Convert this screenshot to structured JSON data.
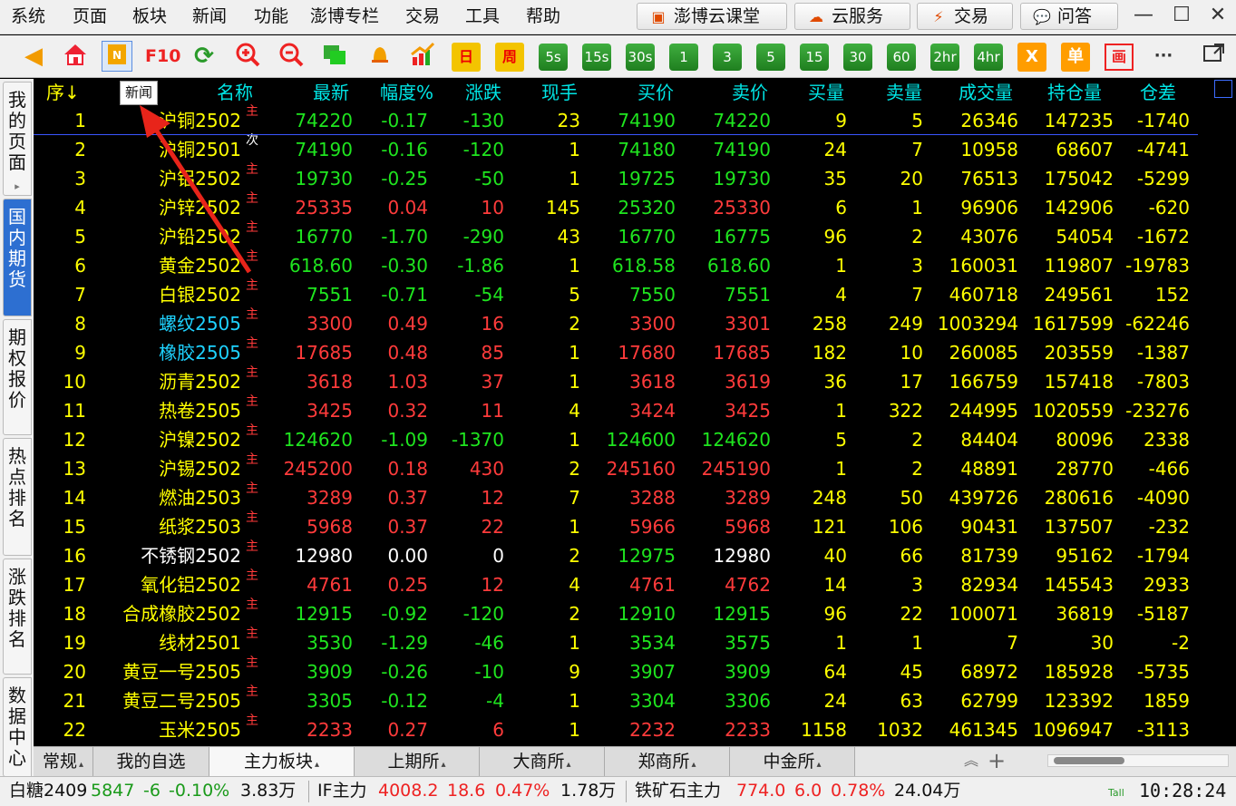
{
  "menu": [
    "系统",
    "页面",
    "板块",
    "新闻",
    "功能",
    "澎博专栏",
    "交易",
    "工具",
    "帮助"
  ],
  "top_buttons": [
    {
      "icon": "graduation-icon",
      "label": "澎博云课堂",
      "color": "#e04a00"
    },
    {
      "icon": "cloud-icon",
      "label": "云服务",
      "color": "#e04a00"
    },
    {
      "icon": "lightning-icon",
      "label": "交易",
      "color": "#e04a00"
    },
    {
      "icon": "chat-icon",
      "label": "问答",
      "color": "#666666"
    }
  ],
  "toolbar": {
    "f10_label": "F10",
    "day_label": "日",
    "week_label": "周",
    "periods": [
      "5s",
      "15s",
      "30s",
      "1",
      "3",
      "5",
      "15",
      "30",
      "60",
      "2hr",
      "4hr"
    ],
    "x_label": "X",
    "single_label": "单",
    "draw_label": "画",
    "more_label": "···"
  },
  "sidebar_tabs": [
    {
      "label": "我的页面",
      "arrow": "▸",
      "active": false
    },
    {
      "label": "国内期货",
      "active": true
    },
    {
      "label": "期权报价",
      "active": false
    },
    {
      "label": "热点排名",
      "active": false
    },
    {
      "label": "涨跌排名",
      "active": false
    },
    {
      "label": "数据中心",
      "active": false
    }
  ],
  "tooltip": "新闻",
  "columns": [
    "序↓",
    "名称",
    "最新",
    "幅度%",
    "涨跌",
    "现手",
    "买价",
    "卖价",
    "买量",
    "卖量",
    "成交量",
    "持仓量",
    "仓差"
  ],
  "rows": [
    {
      "i": "1",
      "n": "沪铜2502",
      "t": "主",
      "nc": "yellow",
      "p": "74220",
      "pct": "-0.17",
      "chg": "-130",
      "hand": "23",
      "bid": "74190",
      "ask": "74220",
      "bv": "9",
      "av": "5",
      "vol": "26346",
      "oi": "147235",
      "doi": "-1740",
      "c": "green"
    },
    {
      "i": "2",
      "n": "沪铜2501",
      "t": "次",
      "nc": "yellow",
      "p": "74190",
      "pct": "-0.16",
      "chg": "-120",
      "hand": "1",
      "bid": "74180",
      "ask": "74190",
      "bv": "24",
      "av": "7",
      "vol": "10958",
      "oi": "68607",
      "doi": "-4741",
      "c": "green"
    },
    {
      "i": "3",
      "n": "沪铝2502",
      "t": "主",
      "nc": "yellow",
      "p": "19730",
      "pct": "-0.25",
      "chg": "-50",
      "hand": "1",
      "bid": "19725",
      "ask": "19730",
      "bv": "35",
      "av": "20",
      "vol": "76513",
      "oi": "175042",
      "doi": "-5299",
      "c": "green"
    },
    {
      "i": "4",
      "n": "沪锌2502",
      "t": "主",
      "nc": "yellow",
      "p": "25335",
      "pct": "0.04",
      "chg": "10",
      "hand": "145",
      "bid": "25320",
      "ask": "25330",
      "bv": "6",
      "av": "1",
      "vol": "96906",
      "oi": "142906",
      "doi": "-620",
      "c": "red",
      "bidc": "green",
      "askc": "red"
    },
    {
      "i": "5",
      "n": "沪铅2502",
      "t": "主",
      "nc": "yellow",
      "p": "16770",
      "pct": "-1.70",
      "chg": "-290",
      "hand": "43",
      "bid": "16770",
      "ask": "16775",
      "bv": "96",
      "av": "2",
      "vol": "43076",
      "oi": "54054",
      "doi": "-1672",
      "c": "green"
    },
    {
      "i": "6",
      "n": "黄金2502",
      "t": "主",
      "nc": "yellow",
      "p": "618.60",
      "pct": "-0.30",
      "chg": "-1.86",
      "hand": "1",
      "bid": "618.58",
      "ask": "618.60",
      "bv": "1",
      "av": "3",
      "vol": "160031",
      "oi": "119807",
      "doi": "-19783",
      "c": "green"
    },
    {
      "i": "7",
      "n": "白银2502",
      "t": "主",
      "nc": "yellow",
      "p": "7551",
      "pct": "-0.71",
      "chg": "-54",
      "hand": "5",
      "bid": "7550",
      "ask": "7551",
      "bv": "4",
      "av": "7",
      "vol": "460718",
      "oi": "249561",
      "doi": "152",
      "c": "green"
    },
    {
      "i": "8",
      "n": "螺纹2505",
      "t": "主",
      "nc": "cyan",
      "p": "3300",
      "pct": "0.49",
      "chg": "16",
      "hand": "2",
      "bid": "3300",
      "ask": "3301",
      "bv": "258",
      "av": "249",
      "vol": "1003294",
      "oi": "1617599",
      "doi": "-62246",
      "c": "red"
    },
    {
      "i": "9",
      "n": "橡胶2505",
      "t": "主",
      "nc": "cyan",
      "p": "17685",
      "pct": "0.48",
      "chg": "85",
      "hand": "1",
      "bid": "17680",
      "ask": "17685",
      "bv": "182",
      "av": "10",
      "vol": "260085",
      "oi": "203559",
      "doi": "-1387",
      "c": "red"
    },
    {
      "i": "10",
      "n": "沥青2502",
      "t": "主",
      "nc": "yellow",
      "p": "3618",
      "pct": "1.03",
      "chg": "37",
      "hand": "1",
      "bid": "3618",
      "ask": "3619",
      "bv": "36",
      "av": "17",
      "vol": "166759",
      "oi": "157418",
      "doi": "-7803",
      "c": "red"
    },
    {
      "i": "11",
      "n": "热卷2505",
      "t": "主",
      "nc": "yellow",
      "p": "3425",
      "pct": "0.32",
      "chg": "11",
      "hand": "4",
      "bid": "3424",
      "ask": "3425",
      "bv": "1",
      "av": "322",
      "vol": "244995",
      "oi": "1020559",
      "doi": "-23276",
      "c": "red"
    },
    {
      "i": "12",
      "n": "沪镍2502",
      "t": "主",
      "nc": "yellow",
      "p": "124620",
      "pct": "-1.09",
      "chg": "-1370",
      "hand": "1",
      "bid": "124600",
      "ask": "124620",
      "bv": "5",
      "av": "2",
      "vol": "84404",
      "oi": "80096",
      "doi": "2338",
      "c": "green"
    },
    {
      "i": "13",
      "n": "沪锡2502",
      "t": "主",
      "nc": "yellow",
      "p": "245200",
      "pct": "0.18",
      "chg": "430",
      "hand": "2",
      "bid": "245160",
      "ask": "245190",
      "bv": "1",
      "av": "2",
      "vol": "48891",
      "oi": "28770",
      "doi": "-466",
      "c": "red"
    },
    {
      "i": "14",
      "n": "燃油2503",
      "t": "主",
      "nc": "yellow",
      "p": "3289",
      "pct": "0.37",
      "chg": "12",
      "hand": "7",
      "bid": "3288",
      "ask": "3289",
      "bv": "248",
      "av": "50",
      "vol": "439726",
      "oi": "280616",
      "doi": "-4090",
      "c": "red"
    },
    {
      "i": "15",
      "n": "纸浆2503",
      "t": "主",
      "nc": "yellow",
      "p": "5968",
      "pct": "0.37",
      "chg": "22",
      "hand": "1",
      "bid": "5966",
      "ask": "5968",
      "bv": "121",
      "av": "106",
      "vol": "90431",
      "oi": "137507",
      "doi": "-232",
      "c": "red"
    },
    {
      "i": "16",
      "n": "不锈钢2502",
      "t": "主",
      "nc": "white",
      "p": "12980",
      "pct": "0.00",
      "chg": "0",
      "hand": "2",
      "bid": "12975",
      "ask": "12980",
      "bv": "40",
      "av": "66",
      "vol": "81739",
      "oi": "95162",
      "doi": "-1794",
      "c": "white",
      "bidc": "green",
      "askc": "white"
    },
    {
      "i": "17",
      "n": "氧化铝2502",
      "t": "主",
      "nc": "yellow",
      "p": "4761",
      "pct": "0.25",
      "chg": "12",
      "hand": "4",
      "bid": "4761",
      "ask": "4762",
      "bv": "14",
      "av": "3",
      "vol": "82934",
      "oi": "145543",
      "doi": "2933",
      "c": "red"
    },
    {
      "i": "18",
      "n": "合成橡胶2502",
      "t": "主",
      "nc": "yellow",
      "p": "12915",
      "pct": "-0.92",
      "chg": "-120",
      "hand": "2",
      "bid": "12910",
      "ask": "12915",
      "bv": "96",
      "av": "22",
      "vol": "100071",
      "oi": "36819",
      "doi": "-5187",
      "c": "green"
    },
    {
      "i": "19",
      "n": "线材2501",
      "t": "主",
      "nc": "yellow",
      "p": "3530",
      "pct": "-1.29",
      "chg": "-46",
      "hand": "1",
      "bid": "3534",
      "ask": "3575",
      "bv": "1",
      "av": "1",
      "vol": "7",
      "oi": "30",
      "doi": "-2",
      "c": "green"
    },
    {
      "i": "20",
      "n": "黄豆一号2505",
      "t": "主",
      "nc": "yellow",
      "p": "3909",
      "pct": "-0.26",
      "chg": "-10",
      "hand": "9",
      "bid": "3907",
      "ask": "3909",
      "bv": "64",
      "av": "45",
      "vol": "68972",
      "oi": "185928",
      "doi": "-5735",
      "c": "green"
    },
    {
      "i": "21",
      "n": "黄豆二号2505",
      "t": "主",
      "nc": "yellow",
      "p": "3305",
      "pct": "-0.12",
      "chg": "-4",
      "hand": "1",
      "bid": "3304",
      "ask": "3306",
      "bv": "24",
      "av": "63",
      "vol": "62799",
      "oi": "123392",
      "doi": "1859",
      "c": "green"
    },
    {
      "i": "22",
      "n": "玉米2505",
      "t": "主",
      "nc": "yellow",
      "p": "2233",
      "pct": "0.27",
      "chg": "6",
      "hand": "1",
      "bid": "2232",
      "ask": "2233",
      "bv": "1158",
      "av": "1032",
      "vol": "461345",
      "oi": "1096947",
      "doi": "-3113",
      "c": "red"
    }
  ],
  "market_tabs": [
    {
      "label": "常规",
      "active": false,
      "tri": "▴"
    },
    {
      "label": "我的自选",
      "active": false,
      "tri": ""
    },
    {
      "label": "主力板块",
      "active": true,
      "tri": "▴"
    },
    {
      "label": "上期所",
      "active": false,
      "tri": "▴"
    },
    {
      "label": "大商所",
      "active": false,
      "tri": "▴"
    },
    {
      "label": "郑商所",
      "active": false,
      "tri": "▴"
    },
    {
      "label": "中金所",
      "active": false,
      "tri": "▴"
    }
  ],
  "tabs_controls": {
    "up": "︽",
    "add": "+"
  },
  "status": [
    {
      "name": "白糖2409",
      "price": "5847",
      "chg": "-6",
      "pct": "-0.10%",
      "vol": "3.83万",
      "color": "green"
    },
    {
      "name": "IF主力",
      "price": "4008.2",
      "chg": "18.6",
      "pct": "0.47%",
      "vol": "1.78万",
      "color": "red"
    },
    {
      "name": "铁矿石主力",
      "price": "774.0",
      "chg": "6.0",
      "pct": "0.78%",
      "vol": "24.04万",
      "color": "red"
    }
  ],
  "signal_label": "Tall",
  "clock": "10:28:24"
}
